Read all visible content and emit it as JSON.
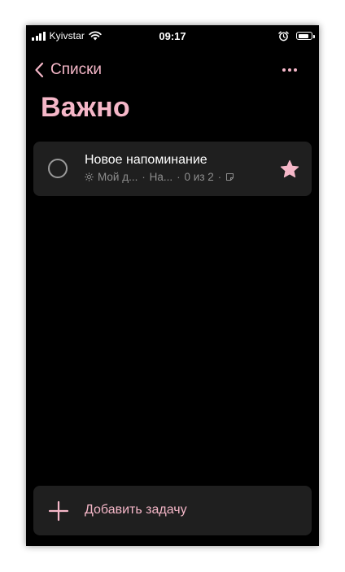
{
  "status_bar": {
    "carrier": "Kyivstar",
    "time": "09:17"
  },
  "nav": {
    "back_label": "Списки",
    "title": "Важно"
  },
  "tasks": [
    {
      "title": "Новое напоминание",
      "list_name": "Мой д...",
      "reminder": "На...",
      "steps": "0 из 2",
      "important": true
    }
  ],
  "add_task": {
    "label": "Добавить задачу"
  },
  "colors": {
    "accent": "#f5b7c8",
    "background": "#000000",
    "card": "#1f1f1f",
    "secondary_text": "#8e8e8e"
  },
  "icons": {
    "back": "chevron-left-icon",
    "more": "more-dots-icon",
    "check": "circle-checkbox-icon",
    "star": "star-filled-icon",
    "my_day": "sun-icon",
    "note": "note-icon",
    "add": "plus-icon"
  }
}
